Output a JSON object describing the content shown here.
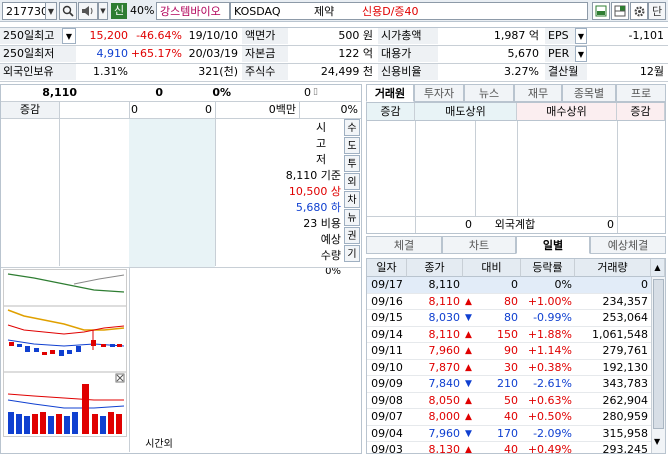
{
  "toolbar": {
    "code": "217730",
    "credit_badge": "신",
    "margin": "40%",
    "name": "강스템바이오",
    "market": "KOSDAQ",
    "sector": "제약",
    "credit_info": "신용D/증40",
    "right_btn": "단"
  },
  "info": {
    "r1": {
      "l1": "250일최고",
      "v1": "15,200",
      "p1": "-46.64%",
      "d1": "19/10/10",
      "l2": "액면가",
      "v2": "500 원",
      "l3": "시가총액",
      "v3": "1,987 억",
      "l4": "EPS",
      "v4": "-1,101"
    },
    "r2": {
      "l1": "250일최저",
      "v1": "4,910",
      "p1": "+65.17%",
      "d1": "20/03/19",
      "l2": "자본금",
      "v2": "122 억",
      "l3": "대용가",
      "v3": "5,670",
      "l4": "PER",
      "v4": ""
    },
    "r3": {
      "l1": "외국인보유",
      "v1": "1.31%",
      "v1b": "321(천)",
      "l2": "주식수",
      "v2": "24,499 천",
      "l3": "신용비율",
      "v3": "3.27%",
      "l4": "결산월",
      "v4": "12월"
    }
  },
  "quote": {
    "price": "8,110",
    "change": "0",
    "rate": "0%",
    "vol": "0",
    "change_label": "증감",
    "v_a": "0",
    "v_b": "0",
    "vol_unit": "0백만",
    "vol_rate": "0%"
  },
  "center": {
    "labels": [
      "시",
      "고",
      "저"
    ],
    "base": "8,110 기준",
    "upper": "10,500 상",
    "lower": "5,680 하",
    "ratio": "23 비용",
    "expect1": "예상",
    "expect2": "수량",
    "expect_rate": "0%",
    "side_tabs": [
      "수",
      "도",
      "투",
      "외",
      "차",
      "뉴",
      "권",
      "기"
    ],
    "time_label": "시간외"
  },
  "broker": {
    "tabs": [
      "거래원",
      "투자자",
      "뉴스",
      "재무",
      "종목별",
      "프로"
    ],
    "header": [
      "증감",
      "매도상위",
      "매수상위",
      "증감"
    ],
    "foreign": {
      "left": "0",
      "label": "외국계합",
      "right": "0"
    }
  },
  "daily": {
    "tabs": [
      "체결",
      "차트",
      "일별",
      "예상체결"
    ],
    "header": [
      "일자",
      "종가",
      "대비",
      "등락률",
      "거래량"
    ],
    "rows": [
      {
        "date": "09/17",
        "close": "8,110",
        "dir": "",
        "diff": "0",
        "rate": "0%",
        "vol": "0",
        "c": "k"
      },
      {
        "date": "09/16",
        "close": "8,110",
        "dir": "▲",
        "diff": "80",
        "rate": "+1.00%",
        "vol": "234,357",
        "c": "r"
      },
      {
        "date": "09/15",
        "close": "8,030",
        "dir": "▼",
        "diff": "80",
        "rate": "-0.99%",
        "vol": "253,064",
        "c": "b"
      },
      {
        "date": "09/14",
        "close": "8,110",
        "dir": "▲",
        "diff": "150",
        "rate": "+1.88%",
        "vol": "1,061,548",
        "c": "r"
      },
      {
        "date": "09/11",
        "close": "7,960",
        "dir": "▲",
        "diff": "90",
        "rate": "+1.14%",
        "vol": "279,761",
        "c": "r"
      },
      {
        "date": "09/10",
        "close": "7,870",
        "dir": "▲",
        "diff": "30",
        "rate": "+0.38%",
        "vol": "192,130",
        "c": "r"
      },
      {
        "date": "09/09",
        "close": "7,840",
        "dir": "▼",
        "diff": "210",
        "rate": "-2.61%",
        "vol": "343,783",
        "c": "b"
      },
      {
        "date": "09/08",
        "close": "8,050",
        "dir": "▲",
        "diff": "50",
        "rate": "+0.63%",
        "vol": "262,904",
        "c": "r"
      },
      {
        "date": "09/07",
        "close": "8,000",
        "dir": "▲",
        "diff": "40",
        "rate": "+0.50%",
        "vol": "280,959",
        "c": "r"
      },
      {
        "date": "09/04",
        "close": "7,960",
        "dir": "▼",
        "diff": "170",
        "rate": "-2.09%",
        "vol": "315,958",
        "c": "b"
      },
      {
        "date": "09/03",
        "close": "8,130",
        "dir": "▲",
        "diff": "40",
        "rate": "+0.49%",
        "vol": "293,245",
        "c": "r"
      }
    ]
  },
  "colors": {
    "up": "#e00000",
    "down": "#1040d0",
    "accent": "#2e7d32"
  }
}
